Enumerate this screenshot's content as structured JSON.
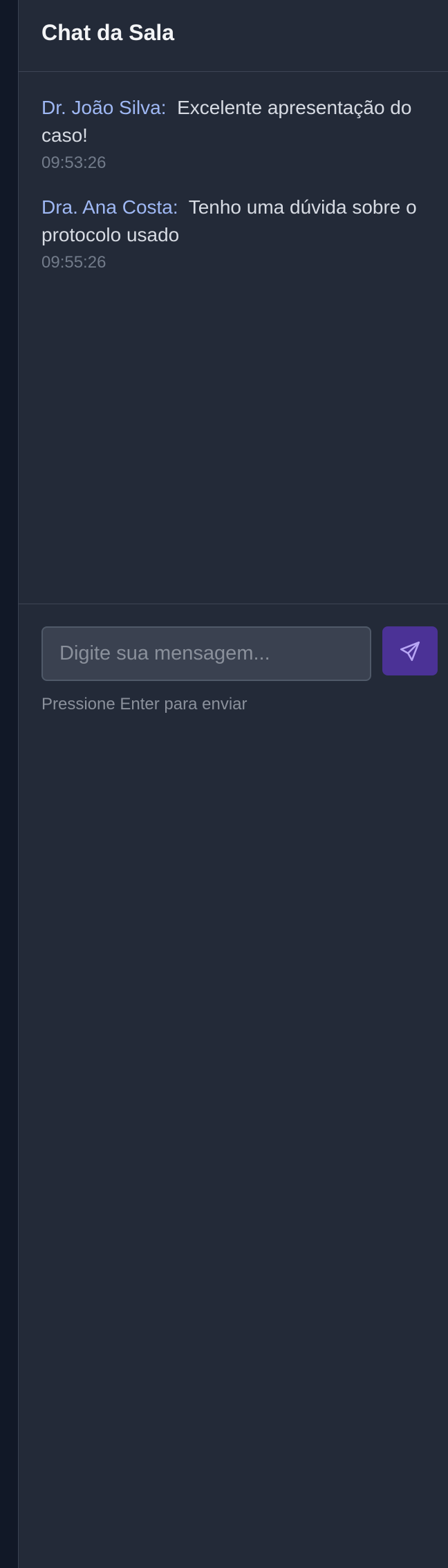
{
  "chat": {
    "title": "Chat da Sala",
    "messages": [
      {
        "author": "Dr. João Silva:",
        "text": "Excelente apresentação do caso!",
        "time": "09:53:26"
      },
      {
        "author": "Dra. Ana Costa:",
        "text": "Tenho uma dúvida sobre o protocolo usado",
        "time": "09:55:26"
      }
    ],
    "input": {
      "placeholder": "Digite sua mensagem...",
      "value": ""
    },
    "send_icon": "send-icon",
    "hint": "Pressione Enter para enviar"
  }
}
